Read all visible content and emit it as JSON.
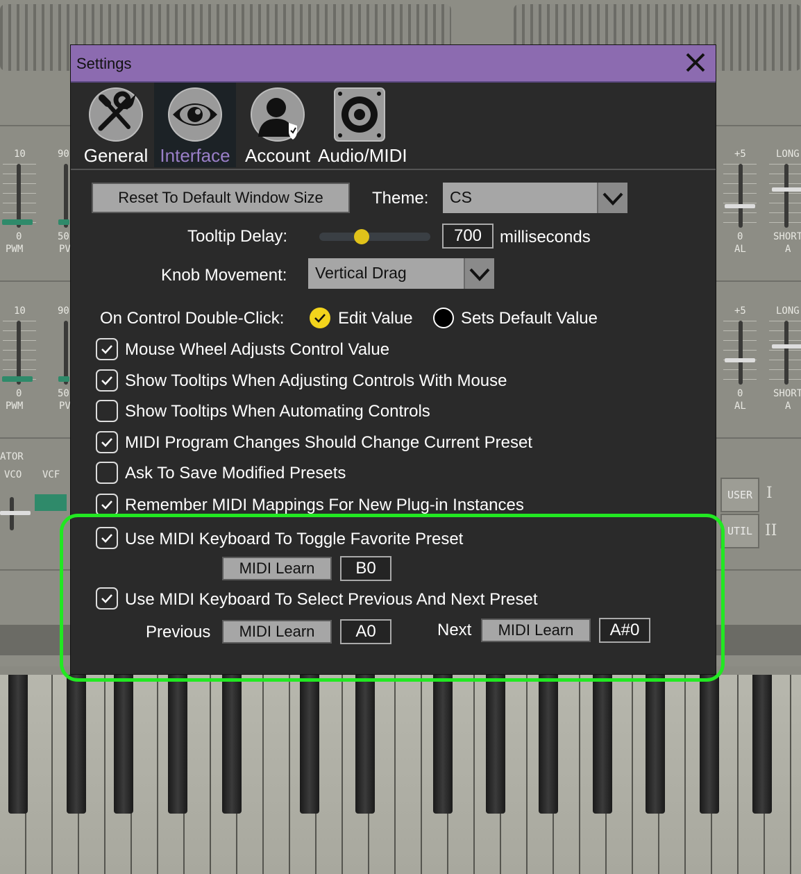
{
  "background": {
    "slider_labels_left": [
      "10",
      "90",
      "0",
      "50",
      "PWM",
      "PV",
      "10",
      "90",
      "0",
      "50",
      "PWM",
      "PV"
    ],
    "slider_labels_right": [
      "+5",
      "LONG",
      "0",
      "SHORT",
      "AL",
      "A",
      "+5",
      "LONG",
      "0",
      "SHORT",
      "AL",
      "A"
    ],
    "left_labels": [
      "ATOR",
      "VCO",
      "VCF"
    ],
    "buttons": [
      "USER",
      "UTIL"
    ],
    "roman": [
      "I",
      "II"
    ]
  },
  "dialog": {
    "title": "Settings",
    "tabs": [
      {
        "label": "General",
        "icon": "wrench-screwdriver-icon"
      },
      {
        "label": "Interface",
        "icon": "eye-icon"
      },
      {
        "label": "Account",
        "icon": "user-shield-icon"
      },
      {
        "label": "Audio/MIDI",
        "icon": "speaker-icon"
      }
    ],
    "active_tab": "Interface",
    "reset_button": "Reset To Default Window Size",
    "theme_label": "Theme:",
    "theme_value": "CS",
    "tooltip_label": "Tooltip Delay:",
    "tooltip_value": "700",
    "tooltip_unit": "milliseconds",
    "tooltip_slider_fraction": 0.36,
    "knob_label": "Knob Movement:",
    "knob_value": "Vertical Drag",
    "dblclick_label": "On Control Double-Click:",
    "radio_edit": "Edit Value",
    "radio_default": "Sets Default Value",
    "checkboxes": [
      {
        "label": "Mouse Wheel Adjusts Control Value",
        "checked": true
      },
      {
        "label": "Show Tooltips When Adjusting Controls With Mouse",
        "checked": true
      },
      {
        "label": "Show Tooltips When Automating Controls",
        "checked": false
      },
      {
        "label": "MIDI Program Changes Should Change Current Preset",
        "checked": true
      },
      {
        "label": "Ask To Save Modified Presets",
        "checked": false
      },
      {
        "label": "Remember MIDI Mappings For New Plug-in Instances",
        "checked": true
      }
    ],
    "favorite": {
      "label": "Use MIDI Keyboard To Toggle Favorite Preset",
      "checked": true,
      "learn": "MIDI Learn",
      "note": "B0"
    },
    "prevnext": {
      "label": "Use MIDI Keyboard To Select Previous And Next Preset",
      "checked": true,
      "prev_label": "Previous",
      "prev_learn": "MIDI Learn",
      "prev_note": "A0",
      "next_label": "Next",
      "next_learn": "MIDI Learn",
      "next_note": "A#0"
    }
  }
}
